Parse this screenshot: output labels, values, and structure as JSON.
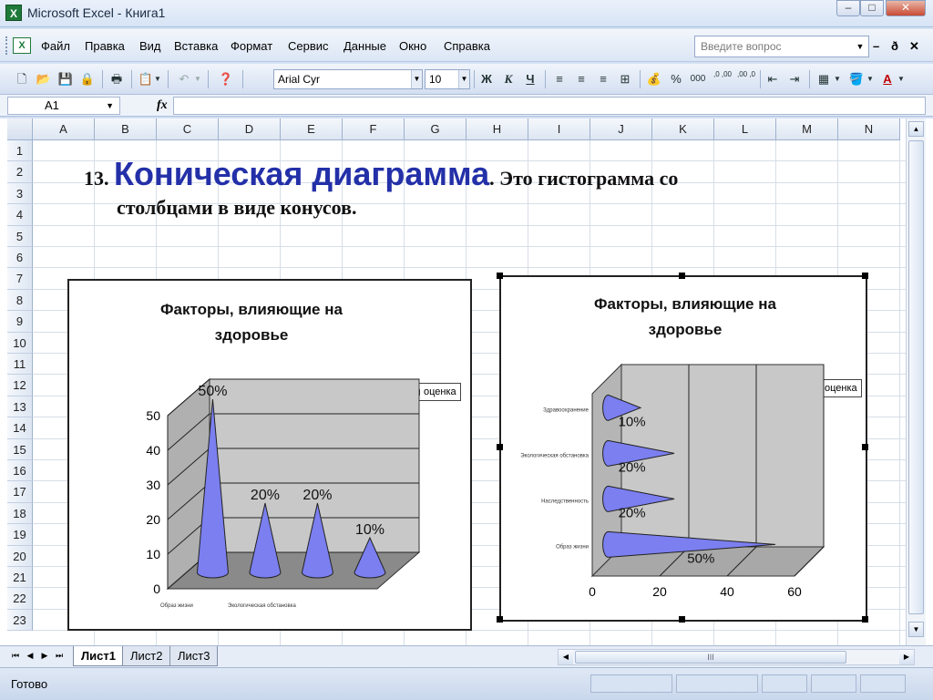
{
  "window": {
    "title": "Microsoft Excel - Книга1",
    "app_icon": "X",
    "buttons": [
      "–",
      "□",
      "✕"
    ]
  },
  "menu": {
    "doc_icon": "X",
    "items": [
      "Файл",
      "Правка",
      "Вид",
      "Вставка",
      "Формат",
      "Сервис",
      "Данные",
      "Окно",
      "Справка"
    ],
    "help_placeholder": "Введите вопрос",
    "mdi_buttons": [
      "–",
      "ð",
      "✕"
    ]
  },
  "toolbar": {
    "font_name": "Arial Cyr",
    "font_size": "10",
    "bold": "Ж",
    "italic": "К",
    "underline": "Ч",
    "percent": "%",
    "thousands": "000",
    "dec_inc": ",0 ,00",
    "dec_dec": ",00 ,0"
  },
  "formula_bar": {
    "cell_ref": "A1",
    "fx": "fx",
    "content": ""
  },
  "columns": [
    "A",
    "B",
    "C",
    "D",
    "E",
    "F",
    "G",
    "H",
    "I",
    "J",
    "K",
    "L",
    "M",
    "N"
  ],
  "rows": [
    "1",
    "2",
    "3",
    "4",
    "5",
    "6",
    "7",
    "8",
    "9",
    "10",
    "11",
    "12",
    "13",
    "14",
    "15",
    "16",
    "17",
    "18",
    "19",
    "20",
    "21",
    "22",
    "23"
  ],
  "heading": {
    "number": "13.",
    "title": "Коническая диаграмма",
    "text1": ". Это гистограмма со",
    "text2": "столбцами в виде конусов."
  },
  "chart_data": [
    {
      "type": "bar",
      "orientation": "vertical",
      "style": "3d-cone",
      "title": "Факторы, влияющие на здоровье",
      "legend": "оценка",
      "legend_position": "top-right",
      "categories": [
        "Образ жизни",
        "Экологическая обстановка",
        "Наследственность",
        "Здравоохранение"
      ],
      "category_labels_shown": [
        "Образ жизни",
        "Экологическая обстановка"
      ],
      "values": [
        50,
        20,
        20,
        10
      ],
      "data_labels": [
        "50%",
        "20%",
        "20%",
        "10%"
      ],
      "yticks": [
        "0",
        "10",
        "20",
        "30",
        "40",
        "50"
      ],
      "ylim": [
        0,
        50
      ]
    },
    {
      "type": "bar",
      "orientation": "horizontal",
      "style": "3d-cone",
      "title": "Факторы, влияющие на здоровье",
      "legend": "оценка",
      "legend_position": "top-right",
      "categories": [
        "Здравоохранение",
        "Экологическая обстановка",
        "Наследственность",
        "Образ жизни"
      ],
      "values": [
        10,
        20,
        20,
        50
      ],
      "data_labels": [
        "10%",
        "20%",
        "20%",
        "50%"
      ],
      "xticks": [
        "0",
        "20",
        "40",
        "60"
      ],
      "xlim": [
        0,
        60
      ]
    }
  ],
  "sheets": {
    "nav": [
      "⏮",
      "◀",
      "▶",
      "⏭"
    ],
    "tabs": [
      "Лист1",
      "Лист2",
      "Лист3"
    ],
    "scroll_grip": "III"
  },
  "status": {
    "text": "Готово"
  },
  "colors": {
    "cone": "#7b7ff0",
    "chart_wall": "#c8c8c8",
    "chart_floor": "#8a8a8a",
    "title_accent": "#2330a8"
  }
}
